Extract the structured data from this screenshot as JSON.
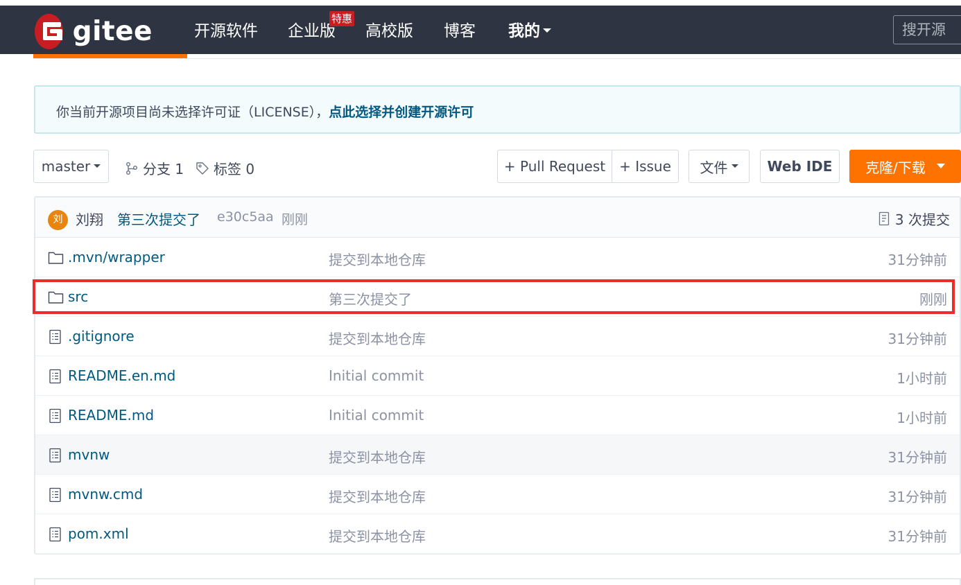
{
  "navbar": {
    "logo_text": "gitee",
    "items": [
      {
        "label": "开源软件"
      },
      {
        "label": "企业版"
      },
      {
        "label": "高校版"
      },
      {
        "label": "博客"
      },
      {
        "label": "我的"
      }
    ],
    "badge": "特惠",
    "search_placeholder": "搜开源"
  },
  "notice": {
    "text": "你当前开源项目尚未选择许可证（LICENSE），",
    "link": "点此选择并创建开源许可"
  },
  "toolbar": {
    "branch": "master",
    "branches_label": "分支 1",
    "tags_label": "标签 0",
    "pull_request": "+ Pull Request",
    "issue": "+ Issue",
    "files": "文件",
    "web_ide": "Web IDE",
    "clone": "克隆/下载"
  },
  "latest_commit": {
    "avatar": "刘",
    "author": "刘翔",
    "message": "第三次提交了",
    "sha": "e30c5aa",
    "time": "刚刚",
    "count_label": "3 次提交"
  },
  "files": [
    {
      "type": "folder",
      "name": ".mvn/wrapper",
      "message": "提交到本地仓库",
      "time": "31分钟前"
    },
    {
      "type": "folder",
      "name": "src",
      "message": "第三次提交了",
      "time": "刚刚"
    },
    {
      "type": "file",
      "name": ".gitignore",
      "message": "提交到本地仓库",
      "time": "31分钟前"
    },
    {
      "type": "file",
      "name": "README.en.md",
      "message": "Initial commit",
      "time": "1小时前"
    },
    {
      "type": "file",
      "name": "README.md",
      "message": "Initial commit",
      "time": "1小时前"
    },
    {
      "type": "file",
      "name": "mvnw",
      "message": "提交到本地仓库",
      "time": "31分钟前"
    },
    {
      "type": "file",
      "name": "mvnw.cmd",
      "message": "提交到本地仓库",
      "time": "31分钟前"
    },
    {
      "type": "file",
      "name": "pom.xml",
      "message": "提交到本地仓库",
      "time": "31分钟前"
    }
  ],
  "colors": {
    "navbar_bg": "#2e3441",
    "brand_red": "#c71d23",
    "accent_orange": "#fe7300",
    "link_blue": "#005980",
    "highlight_red": "#ee2b2b"
  }
}
